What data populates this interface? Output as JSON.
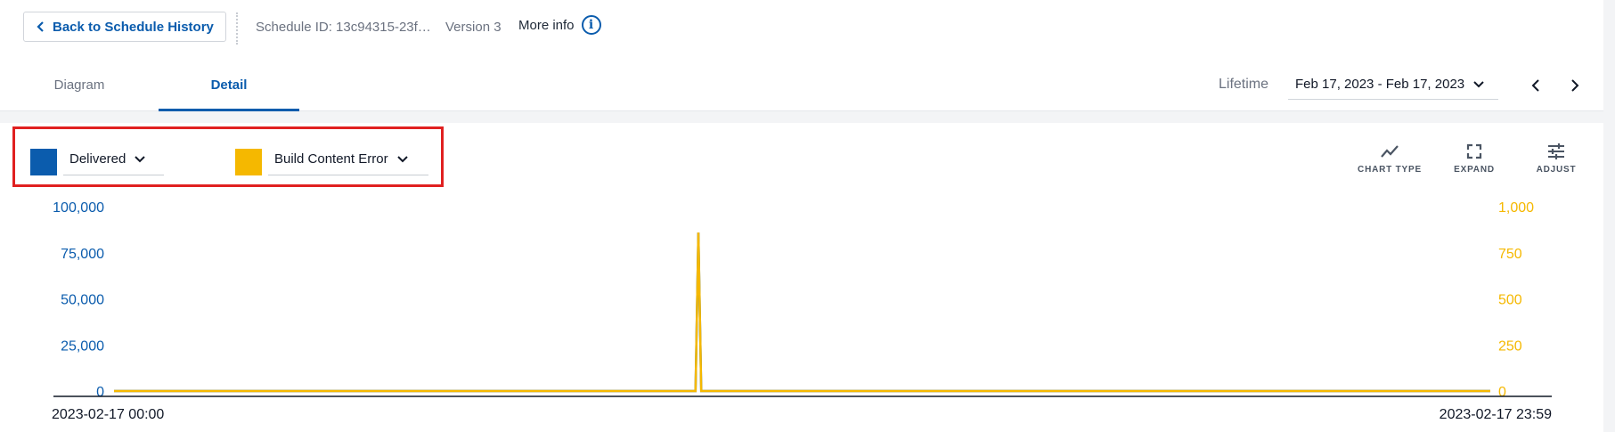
{
  "header": {
    "back_label": "Back to Schedule History",
    "schedule_id": "Schedule ID: 13c94315-23f…",
    "version": "Version 3",
    "more_info": "More info",
    "info_glyph": "i"
  },
  "tabs": [
    {
      "label": "Diagram",
      "active": false
    },
    {
      "label": "Detail",
      "active": true
    }
  ],
  "filter": {
    "lifetime_label": "Lifetime",
    "date_range": "Feb 17, 2023 - Feb 17, 2023"
  },
  "series_selectors": [
    {
      "label": "Delivered",
      "color": "#0b5cad"
    },
    {
      "label": "Build Content Error",
      "color": "#f5b800"
    }
  ],
  "toolbar": {
    "chart_type": "CHART TYPE",
    "expand": "EXPAND",
    "adjust": "ADJUST"
  },
  "colors": {
    "accent": "#0b5cad",
    "secondary": "#f5b800",
    "highlight_border": "#e02020"
  },
  "chart_data": {
    "type": "line",
    "x_start_label": "2023-02-17 00:00",
    "x_end_label": "2023-02-17 23:59",
    "x_range_minutes": [
      0,
      1439
    ],
    "left_axis": {
      "ticks": [
        "100,000",
        "75,000",
        "50,000",
        "25,000",
        "0"
      ],
      "tick_values": [
        100000,
        75000,
        50000,
        25000,
        0
      ],
      "ylim": [
        0,
        100000
      ],
      "color": "#0b5cad"
    },
    "right_axis": {
      "ticks": [
        "1,000",
        "750",
        "500",
        "250",
        "0"
      ],
      "tick_values": [
        1000,
        750,
        500,
        250,
        0
      ],
      "ylim": [
        0,
        1000
      ],
      "color": "#f5b800"
    },
    "series": [
      {
        "name": "Delivered",
        "axis": "left",
        "color": "#0b5cad",
        "points": [
          [
            0,
            0
          ],
          [
            608,
            0
          ],
          [
            611,
            86000
          ],
          [
            614,
            0
          ],
          [
            1439,
            0
          ]
        ]
      },
      {
        "name": "Build Content Error",
        "axis": "right",
        "color": "#f5b800",
        "points": [
          [
            0,
            0
          ],
          [
            608,
            0
          ],
          [
            611,
            860
          ],
          [
            614,
            0
          ],
          [
            1439,
            0
          ]
        ]
      }
    ]
  }
}
